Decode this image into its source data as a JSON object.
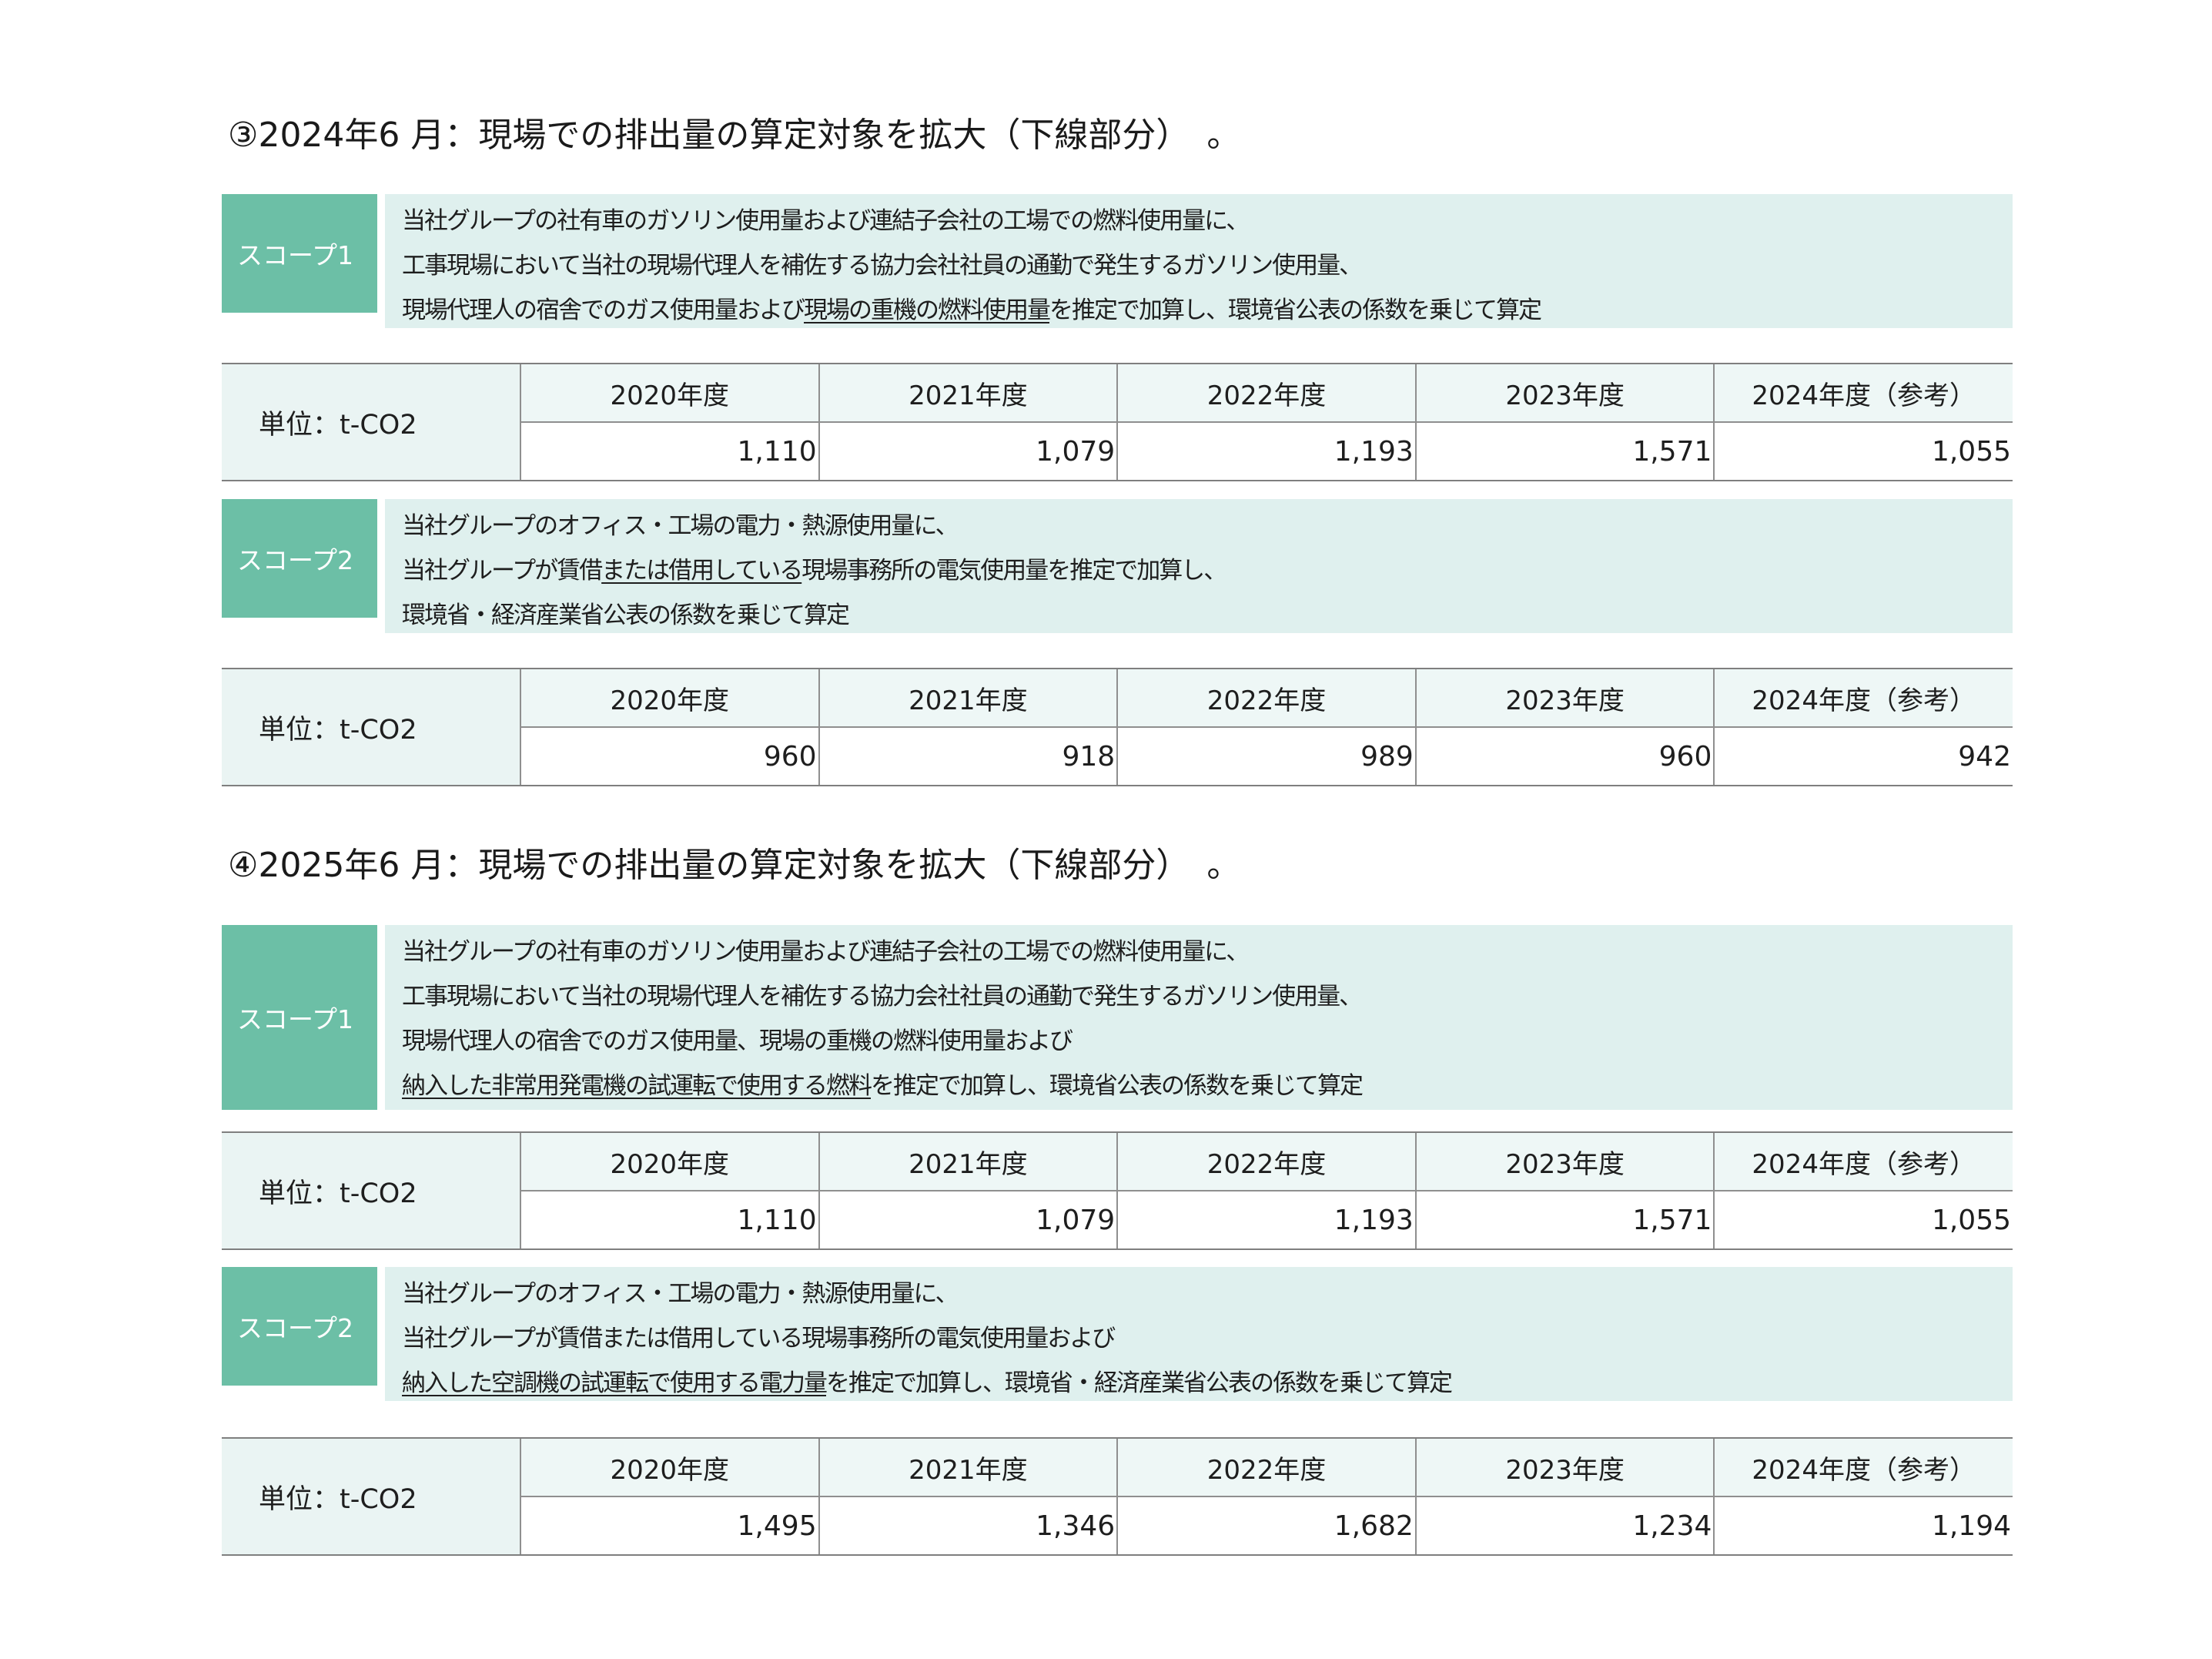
{
  "sections": [
    {
      "title": "③2024年6 月：現場での排出量の算定対象を拡大（下線部分）　。",
      "scope1": {
        "label": "スコープ1",
        "lines": [
          [
            {
              "t": "当社グループの社有車のガソリン使用量および連結子会社の工場での燃料使用量に、",
              "u": false
            }
          ],
          [
            {
              "t": "工事現場において当社の現場代理人を補佐する協力会社社員の通勤で発生するガソリン使用量、",
              "u": false
            }
          ],
          [
            {
              "t": "現場代理人の宿舎でのガス使用量および",
              "u": false
            },
            {
              "t": "現場の重機の燃料使用量",
              "u": true
            },
            {
              "t": "を推定で加算し、環境省公表の係数を乗じて算定",
              "u": false
            }
          ]
        ],
        "table": {
          "unit": "単位：t-CO2",
          "years": [
            "2020年度",
            "2021年度",
            "2022年度",
            "2023年度",
            "2024年度（参考）"
          ],
          "values": [
            "1,110",
            "1,079",
            "1,193",
            "1,571",
            "1,055"
          ]
        }
      },
      "scope2": {
        "label": "スコープ2",
        "lines": [
          [
            {
              "t": "当社グループのオフィス・工場の電力・熱源使用量に、",
              "u": false
            }
          ],
          [
            {
              "t": "当社グループが賃借",
              "u": false
            },
            {
              "t": "または借用している",
              "u": true
            },
            {
              "t": "現場事務所の電気使用量を推定で加算し、",
              "u": false
            }
          ],
          [
            {
              "t": "環境省・経済産業省公表の係数を乗じて算定",
              "u": false
            }
          ]
        ],
        "table": {
          "unit": "単位：t-CO2",
          "years": [
            "2020年度",
            "2021年度",
            "2022年度",
            "2023年度",
            "2024年度（参考）"
          ],
          "values": [
            "960",
            "918",
            "989",
            "960",
            "942"
          ]
        }
      }
    },
    {
      "title": "④2025年6 月：現場での排出量の算定対象を拡大（下線部分）　。",
      "scope1": {
        "label": "スコープ1",
        "lines": [
          [
            {
              "t": "当社グループの社有車のガソリン使用量および連結子会社の工場での燃料使用量に、",
              "u": false
            }
          ],
          [
            {
              "t": "工事現場において当社の現場代理人を補佐する協力会社社員の通勤で発生するガソリン使用量、",
              "u": false
            }
          ],
          [
            {
              "t": "現場代理人の宿舎でのガス使用量、現場の重機の燃料使用量および",
              "u": false
            }
          ],
          [
            {
              "t": "納入した非常用発電機の試運転で使用する燃料",
              "u": true
            },
            {
              "t": "を推定で加算し、環境省公表の係数を乗じて算定",
              "u": false
            }
          ]
        ],
        "table": {
          "unit": "単位：t-CO2",
          "years": [
            "2020年度",
            "2021年度",
            "2022年度",
            "2023年度",
            "2024年度（参考）"
          ],
          "values": [
            "1,110",
            "1,079",
            "1,193",
            "1,571",
            "1,055"
          ]
        }
      },
      "scope2": {
        "label": "スコープ2",
        "lines": [
          [
            {
              "t": "当社グループのオフィス・工場の電力・熱源使用量に、",
              "u": false
            }
          ],
          [
            {
              "t": "当社グループが賃借または借用している現場事務所の電気使用量および",
              "u": false
            }
          ],
          [
            {
              "t": "納入した空調機の試運転で使用する電力量",
              "u": true
            },
            {
              "t": "を推定で加算し、環境省・経済産業省公表の係数を乗じて算定",
              "u": false
            }
          ]
        ],
        "table": {
          "unit": "単位：t-CO2",
          "years": [
            "2020年度",
            "2021年度",
            "2022年度",
            "2023年度",
            "2024年度（参考）"
          ],
          "values": [
            "1,495",
            "1,346",
            "1,682",
            "1,234",
            "1,194"
          ]
        }
      }
    }
  ]
}
